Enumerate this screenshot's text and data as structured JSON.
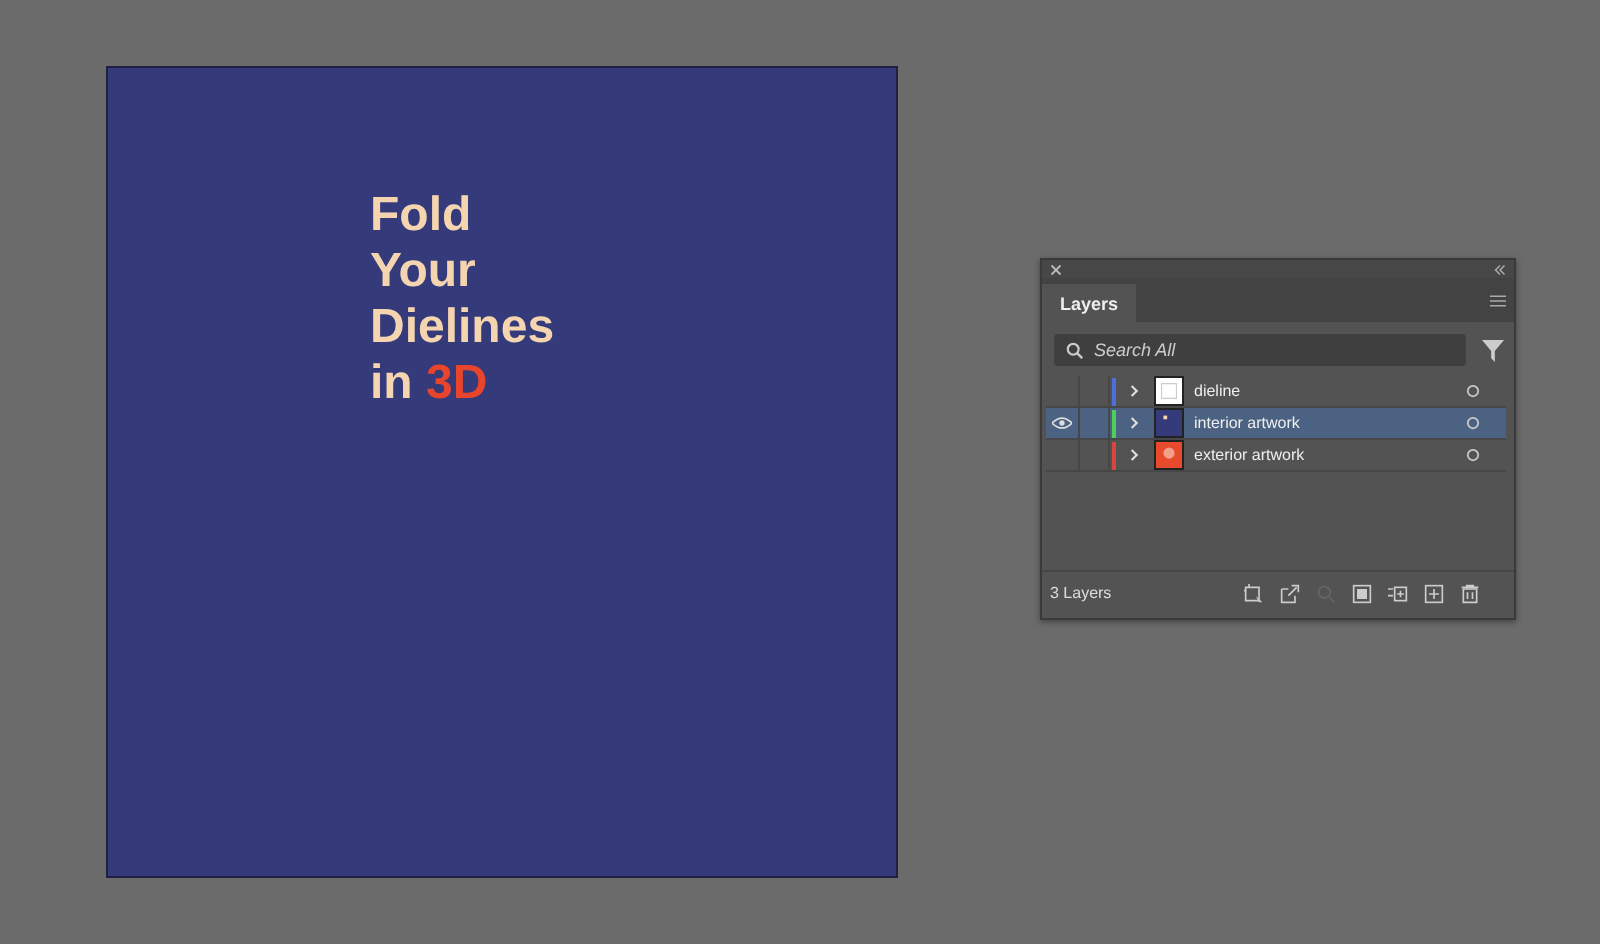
{
  "artboard": {
    "headline": [
      [
        {
          "text": "Fold",
          "accent": false
        }
      ],
      [
        {
          "text": "Your",
          "accent": false
        }
      ],
      [
        {
          "text": "Dielines",
          "accent": false
        }
      ],
      [
        {
          "text": "in ",
          "accent": false
        },
        {
          "text": "3D",
          "accent": true
        }
      ]
    ]
  },
  "layers_panel": {
    "tabs": [
      {
        "label": "Layers",
        "selected": true
      }
    ],
    "search": {
      "placeholder": "Search All"
    },
    "layers": [
      {
        "name": "dieline",
        "visible": false,
        "selected": false,
        "color": "#4f6fd8",
        "kind": "blank"
      },
      {
        "name": "interior artwork",
        "visible": true,
        "selected": true,
        "color": "#4fcf5a",
        "kind": "dark"
      },
      {
        "name": "exterior artwork",
        "visible": false,
        "selected": false,
        "color": "#d8473e",
        "kind": "red"
      }
    ],
    "status": "3 Layers",
    "tools": [
      {
        "kind": "collect",
        "disabled": false
      },
      {
        "kind": "export",
        "disabled": false
      },
      {
        "kind": "locate",
        "disabled": true
      },
      {
        "kind": "mask",
        "disabled": false
      },
      {
        "kind": "sublayer",
        "disabled": false
      },
      {
        "kind": "new",
        "disabled": false
      },
      {
        "kind": "delete",
        "disabled": false
      }
    ]
  }
}
